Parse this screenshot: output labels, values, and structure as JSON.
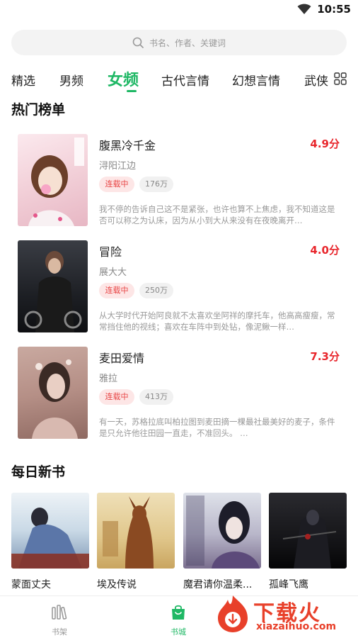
{
  "status_bar": {
    "time": "10:55"
  },
  "search": {
    "placeholder": "书名、作者、关键词"
  },
  "tabs": [
    {
      "label": "精选"
    },
    {
      "label": "男频"
    },
    {
      "label": "女频"
    },
    {
      "label": "古代言情"
    },
    {
      "label": "幻想言情"
    },
    {
      "label": "武侠"
    }
  ],
  "hot_list": {
    "title": "热门榜单",
    "books": [
      {
        "title": "腹黑冷千金",
        "author": "浔阳江边",
        "status": "连载中",
        "count": "176万",
        "score": "4.9分",
        "desc": "我不停的告诉自己这不是紧张，也许也算不上焦虑，我不知道这是否可以称之为认床，因为从小到大从来没有在夜晚离开…"
      },
      {
        "title": "冒险",
        "author": "展大大",
        "status": "连载中",
        "count": "250万",
        "score": "4.0分",
        "desc": "从大学时代开始阿良就不太喜欢坐阿祥的摩托车，他高高瘦瘦，常常挡住他的视线；喜欢在车阵中到处钻，像泥鳅一样…"
      },
      {
        "title": "麦田爱情",
        "author": "雅拉",
        "status": "连载中",
        "count": "413万",
        "score": "7.3分",
        "desc": "有一天，苏格拉底叫柏拉图到麦田摘一棵最社最美好的麦子，条件是只允许他往田园一直走，不准回头。 …"
      }
    ]
  },
  "daily_new": {
    "title": "每日新书",
    "books": [
      {
        "title": "蒙面丈夫"
      },
      {
        "title": "埃及传说"
      },
      {
        "title": "魔君请你温柔..."
      },
      {
        "title": "孤峰飞鹰"
      }
    ]
  },
  "bottom_nav": [
    {
      "label": "书架",
      "icon": "bookshelf-icon"
    },
    {
      "label": "书城",
      "icon": "bookstore-bag-icon"
    }
  ],
  "watermark": {
    "main": "下载火",
    "sub": "xiazaihuo.com"
  },
  "colors": {
    "accent": "#1fb865",
    "score": "#e8262c",
    "status_tag_bg": "#fde6e6"
  }
}
